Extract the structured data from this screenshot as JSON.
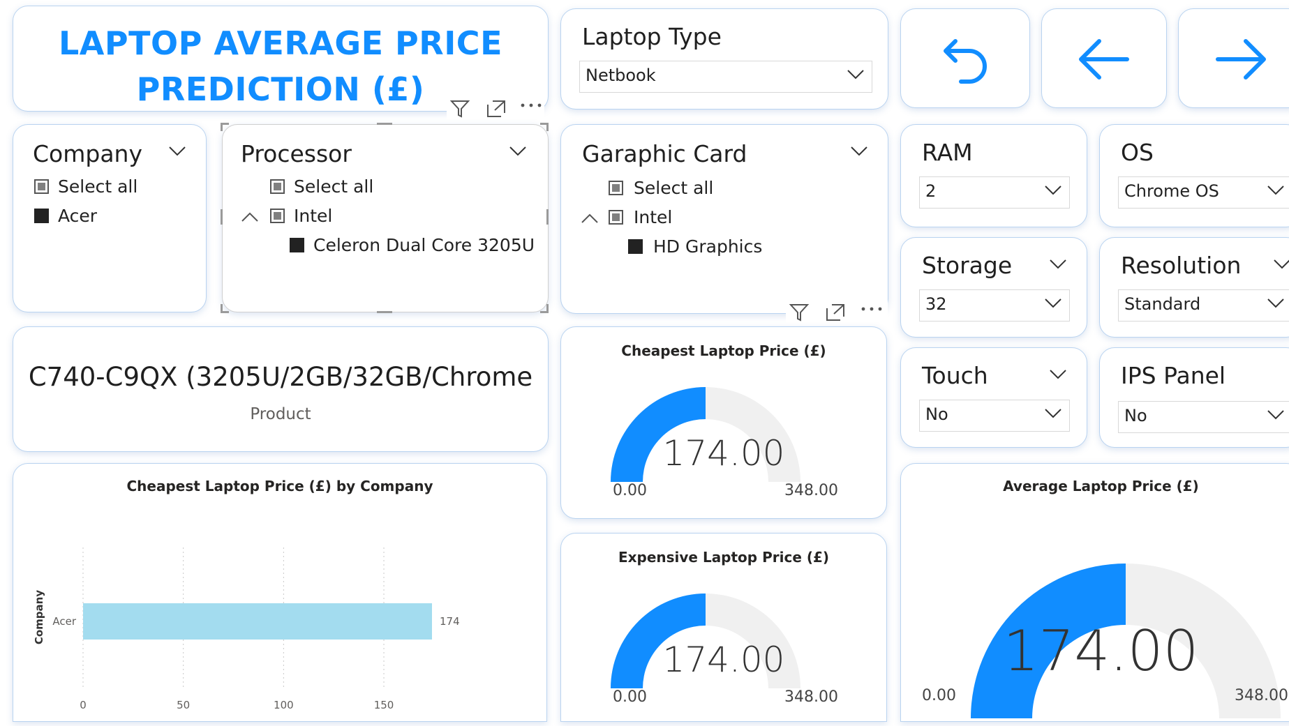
{
  "title": {
    "line1": "LAPTOP AVERAGE PRICE",
    "line2": "PREDICTION (£)"
  },
  "colors": {
    "accent": "#118dff",
    "gauge_fill": "#118dff",
    "gauge_track": "#f0f0f0",
    "bar": "#a3dcef",
    "card_border": "#b9d3f0"
  },
  "laptop_type": {
    "label": "Laptop Type",
    "value": "Netbook"
  },
  "nav": {
    "undo_icon": "undo-icon",
    "back_icon": "arrow-left-icon",
    "forward_icon": "arrow-right-icon"
  },
  "company": {
    "label": "Company",
    "items": [
      {
        "text": "Select all",
        "state": "partial"
      },
      {
        "text": "Acer",
        "state": "checked"
      }
    ]
  },
  "processor": {
    "label": "Processor",
    "select_all": "Select all",
    "group": "Intel",
    "child": "Celeron Dual Core 3205U"
  },
  "graphic_card": {
    "label": "Garaphic Card",
    "select_all": "Select all",
    "group": "Intel",
    "child": "HD Graphics"
  },
  "ram": {
    "label": "RAM",
    "value": "2"
  },
  "os": {
    "label": "OS",
    "value": "Chrome OS"
  },
  "storage": {
    "label": "Storage",
    "value": "32"
  },
  "resolution": {
    "label": "Resolution",
    "value": "Standard"
  },
  "touch": {
    "label": "Touch",
    "value": "No"
  },
  "ips": {
    "label": "IPS Panel",
    "value": "No"
  },
  "product": {
    "name": "C740-C9QX (3205U/2GB/32GB/Chrome",
    "caption": "Product"
  },
  "gauges": {
    "cheapest": {
      "title": "Cheapest Laptop Price (£)",
      "value": 174,
      "value_text": "174.00",
      "min": 0,
      "max": 348,
      "min_text": "0.00",
      "max_text": "348.00"
    },
    "expensive": {
      "title": "Expensive Laptop Price (£)",
      "value": 174,
      "value_text": "174.00",
      "min": 0,
      "max": 348,
      "min_text": "0.00",
      "max_text": "348.00"
    },
    "average": {
      "title": "Average Laptop Price (£)",
      "value": 174,
      "value_text": "174.00",
      "min": 0,
      "max": 348,
      "min_text": "0.00",
      "max_text": "348.00"
    }
  },
  "chart_data": {
    "type": "bar",
    "orientation": "horizontal",
    "title": "Cheapest Laptop Price (£) by Company",
    "ylabel": "Company",
    "xlabel": "",
    "categories": [
      "Acer"
    ],
    "values": [
      174
    ],
    "data_labels": [
      "174"
    ],
    "xlim": [
      0,
      174
    ],
    "x_ticks": [
      0,
      50,
      100,
      150
    ],
    "x_tick_labels": [
      "0",
      "50",
      "100",
      "150"
    ],
    "grid": "vertical dotted"
  }
}
